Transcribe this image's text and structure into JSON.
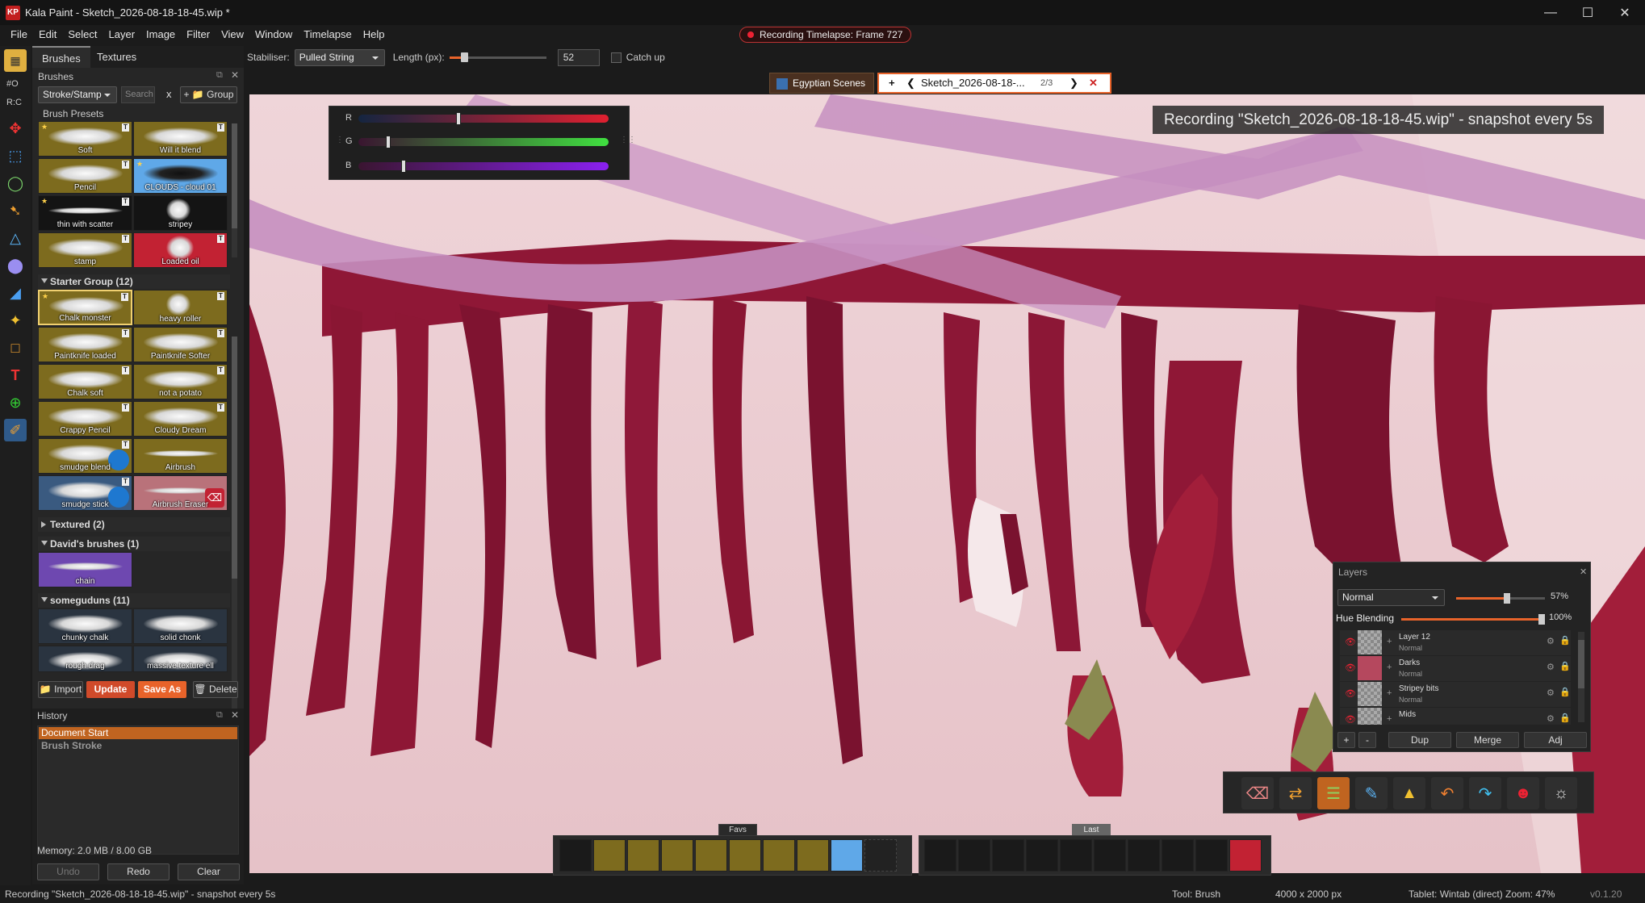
{
  "window": {
    "title": "Kala Paint - Sketch_2026-08-18-18-45.wip *",
    "logo": "KP"
  },
  "menu": [
    "File",
    "Edit",
    "Select",
    "Layer",
    "Image",
    "Filter",
    "View",
    "Window",
    "Timelapse",
    "Help"
  ],
  "recording_pill": "Recording Timelapse: Frame 727",
  "options": {
    "stabiliser_label": "Stabiliser:",
    "stabiliser_value": "Pulled String",
    "length_label": "Length (px):",
    "length_value": "52",
    "catchup_label": "Catch up",
    "length_fraction": 0.12
  },
  "left_indicators": [
    "#O",
    "R:C"
  ],
  "brushes_panel": {
    "tabs": [
      "Brushes",
      "Textures"
    ],
    "title": "Brushes",
    "mode": "Stroke/Stamp",
    "search_placeholder": "Search",
    "clear": "x",
    "group_button": "+ 📁 Group",
    "presets_title": "Brush Presets",
    "presets": [
      "Soft",
      "Will it blend",
      "Pencil",
      "CLOUDS - cloud 01",
      "thin with scatter",
      "stripey",
      "stamp",
      "Loaded oil"
    ],
    "groups": [
      {
        "title": "Starter Group  (12)",
        "open": true,
        "items": [
          "Chalk monster",
          "heavy roller",
          "Paintknife loaded",
          "Paintknife Softer",
          "Chalk soft",
          "not a potato",
          "Crappy Pencil",
          "Cloudy Dream",
          "smudge blend",
          "Airbrush",
          "smudge stick",
          "Airbrush Eraser"
        ]
      },
      {
        "title": "Textured  (2)",
        "open": false,
        "items": []
      },
      {
        "title": "David's brushes  (1)",
        "open": true,
        "items": [
          "chain"
        ]
      },
      {
        "title": "someguduns  (11)",
        "open": true,
        "items": [
          "chunky chalk",
          "solid chonk",
          "rough drag",
          "massive texture ell"
        ]
      }
    ],
    "footer": {
      "import": "Import",
      "update": "Update",
      "save_as": "Save As",
      "delete": "Delete"
    }
  },
  "history": {
    "title": "History",
    "items": [
      "Document Start",
      "Brush Stroke"
    ],
    "memory": "Memory: 2.0 MB / 8.00 GB",
    "undo": "Undo",
    "redo": "Redo",
    "clear": "Clear"
  },
  "doc_tabs": {
    "group": "Egyptian Scenes",
    "add": "+",
    "active": "Sketch_2026-08-18-...",
    "count": "2/3"
  },
  "rgb": {
    "labels": [
      "R",
      "G",
      "B"
    ],
    "values": [
      0.4,
      0.12,
      0.18
    ]
  },
  "recording_overlay": "Recording \"Sketch_2026-08-18-18-45.wip\" - snapshot every 5s",
  "layers": {
    "title": "Layers",
    "blend_mode": "Normal",
    "opacity": "57%",
    "opacity_fraction": 0.57,
    "hue_label": "Hue Blending",
    "hue_value": "100%",
    "rows": [
      {
        "name": "Layer 12",
        "mode": "Normal"
      },
      {
        "name": "Darks",
        "mode": "Normal"
      },
      {
        "name": "Stripey bits",
        "mode": "Normal"
      },
      {
        "name": "Mids",
        "mode": ""
      }
    ],
    "buttons": [
      "+",
      "-",
      "Dup",
      "Merge",
      "Adj"
    ]
  },
  "favbar": {
    "favs_label": "Favs",
    "last_label": "Last"
  },
  "status": {
    "left": "Recording \"Sketch_2026-08-18-18-45.wip\" - snapshot every 5s",
    "tool": "Tool: Brush",
    "size": "4000 x 2000 px",
    "tablet": "Tablet: Wintab (direct)  Zoom: 47%",
    "version": "v0.1.20"
  },
  "colors": {
    "accent": "#e8632a",
    "recording": "#e22233",
    "canvas_bg": "#e9c9cf",
    "maroon": "#8a1633",
    "band": "#c58fc0"
  }
}
